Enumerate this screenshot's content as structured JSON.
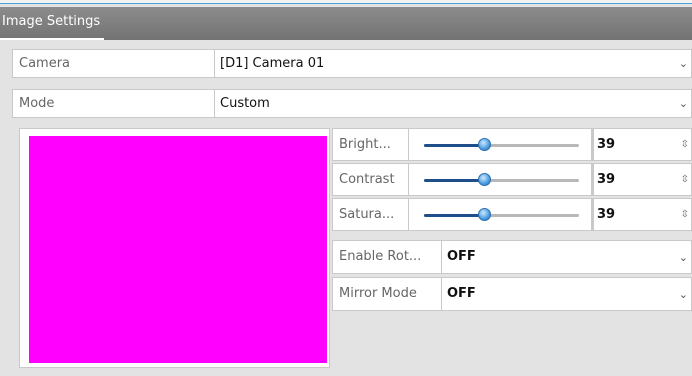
{
  "window": {
    "title": "Image Settings"
  },
  "fields": {
    "camera": {
      "label": "Camera",
      "value": "[D1] Camera 01"
    },
    "mode": {
      "label": "Mode",
      "value": "Custom"
    }
  },
  "preview": {
    "color": "#ff00ff"
  },
  "sliders": [
    {
      "label": "Bright...",
      "value": "39",
      "level": 0.39
    },
    {
      "label": "Contrast",
      "value": "39",
      "level": 0.39
    },
    {
      "label": "Satura...",
      "value": "39",
      "level": 0.39
    }
  ],
  "selects": {
    "rotate": {
      "label": "Enable Rot...",
      "value": "OFF"
    },
    "mirror": {
      "label": "Mirror Mode",
      "value": "OFF"
    }
  },
  "icons": {
    "dropdown": "chevron-down-icon",
    "spinner": "spinner-arrows-icon"
  },
  "colors": {
    "title_bg": "#808080",
    "slider_fill": "#1e4f8a",
    "accent_line": "#4aa0d8"
  }
}
